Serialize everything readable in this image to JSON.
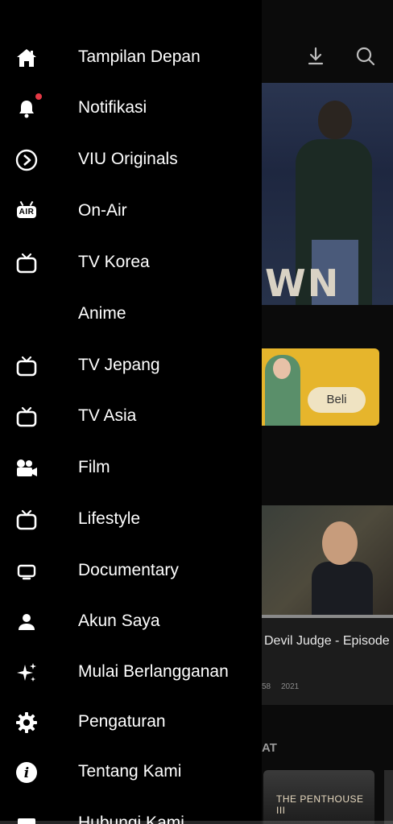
{
  "drawer": {
    "items": [
      {
        "label": "Tampilan Depan",
        "icon": "home-icon"
      },
      {
        "label": "Notifikasi",
        "icon": "bell-icon"
      },
      {
        "label": "VIU Originals",
        "icon": "originals-icon"
      },
      {
        "label": "On-Air",
        "icon": "air-badge-icon"
      },
      {
        "label": "TV Korea",
        "icon": "tv-icon"
      },
      {
        "label": "Anime",
        "icon": ""
      },
      {
        "label": "TV Jepang",
        "icon": "tv-icon"
      },
      {
        "label": "TV Asia",
        "icon": "tv-icon"
      },
      {
        "label": "Film",
        "icon": "film-camera-icon"
      },
      {
        "label": "Lifestyle",
        "icon": "tv-icon"
      },
      {
        "label": "Documentary",
        "icon": "screen-icon"
      },
      {
        "label": "Akun Saya",
        "icon": "person-icon"
      },
      {
        "label": "Mulai Berlangganan",
        "icon": "sparkle-icon"
      },
      {
        "label": "Pengaturan",
        "icon": "gear-icon"
      },
      {
        "label": "Tentang Kami",
        "icon": "info-icon"
      },
      {
        "label": "Hubungi Kami",
        "icon": "mail-icon"
      }
    ],
    "air_badge_text": "AIR",
    "notification_dot_color": "#e53945"
  },
  "background": {
    "hero_title_fragment": "WN",
    "promo_button": "Beli",
    "episode_title": "Devil Judge - Episode",
    "meta_1": "58",
    "meta_2": "2021",
    "section_fragment": "AT",
    "poster_title": "THE PENTHOUSE III"
  }
}
